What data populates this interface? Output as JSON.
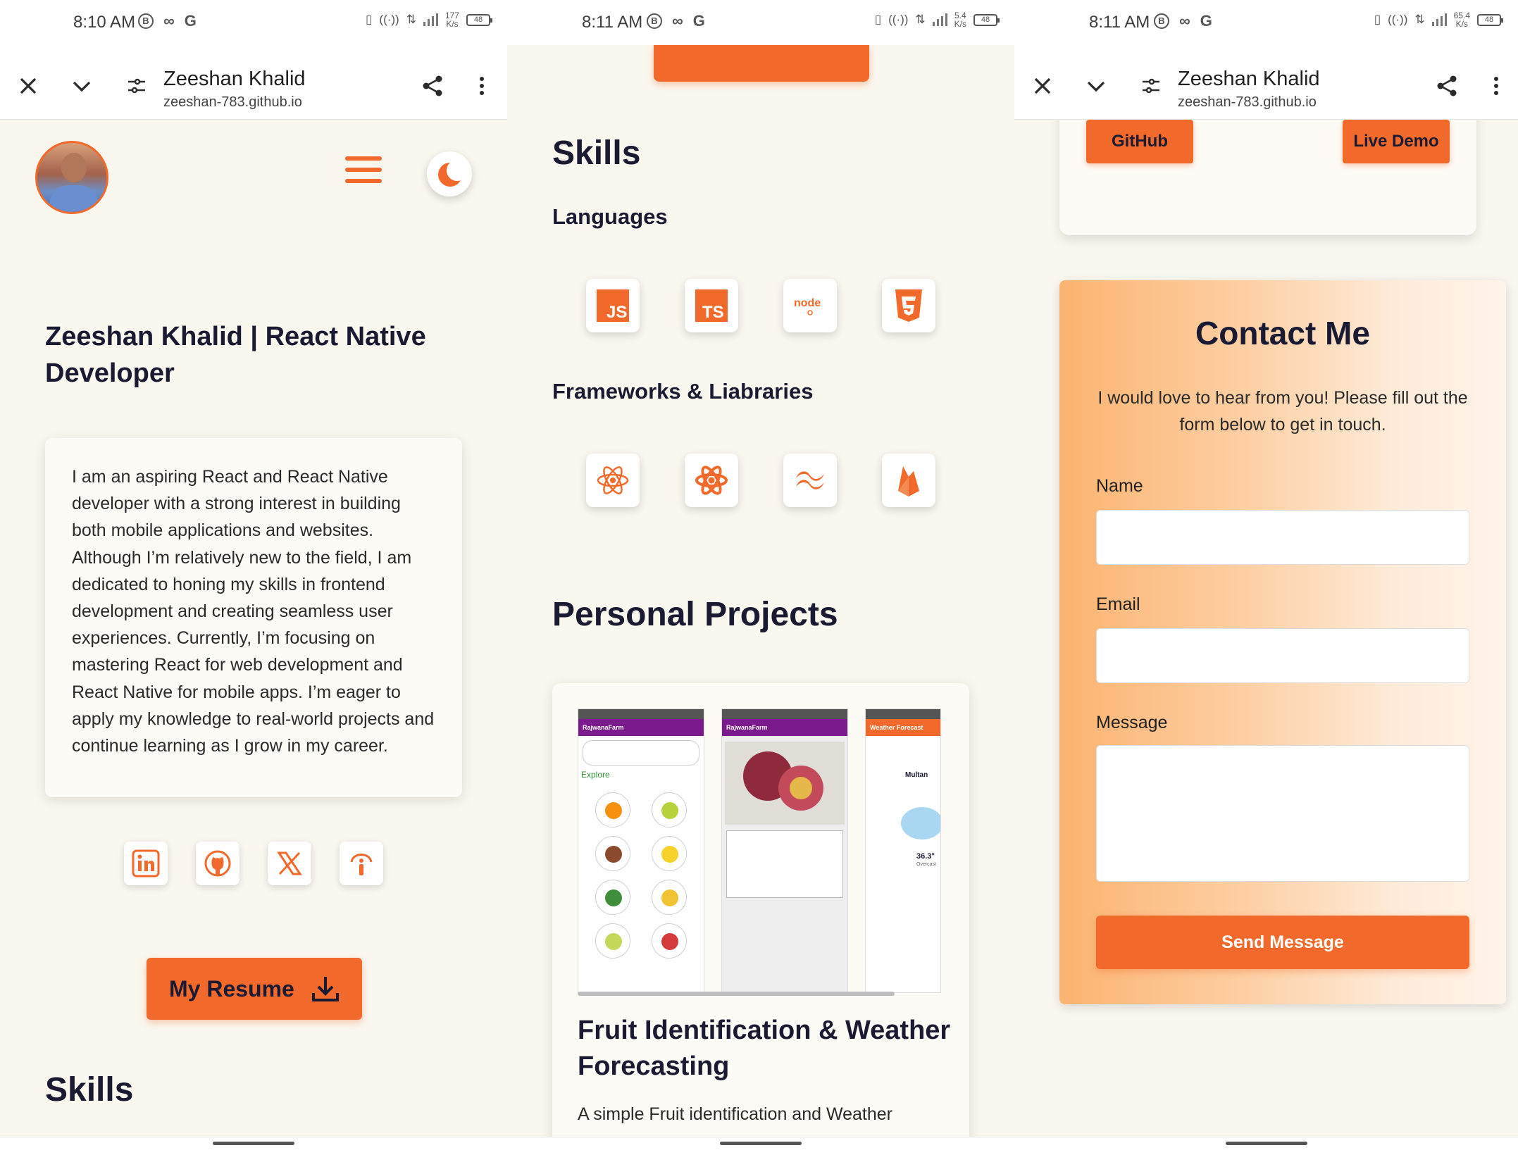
{
  "screens": [
    {
      "status": {
        "time": "8:10 AM",
        "net_speed": "177\nK/s",
        "net_type": "4G",
        "battery": "48"
      },
      "browser": {
        "title": "Zeeshan Khalid",
        "url": "zeeshan-783.github.io"
      }
    },
    {
      "status": {
        "time": "8:11 AM",
        "net_speed": "5.4\nK/s",
        "net_type": "4G",
        "battery": "48"
      }
    },
    {
      "status": {
        "time": "8:11 AM",
        "net_speed": "65.4\nK/s",
        "net_type": "4G",
        "battery": "48"
      },
      "browser": {
        "title": "Zeeshan Khalid",
        "url": "zeeshan-783.github.io"
      }
    }
  ],
  "hero": {
    "title": "Zeeshan Khalid | React Native Developer",
    "about": "I am an aspiring React and React Native developer with a strong interest in building both mobile applications and websites. Although I’m relatively new to the field, I am dedicated to honing my skills in frontend development and creating seamless user experiences. Currently, I’m focusing on mastering React for web development and React Native for mobile apps. I’m eager to apply my knowledge to real-world projects and continue learning as I grow in my career."
  },
  "social_icons": [
    "linkedin-icon",
    "github-icon",
    "x-twitter-icon",
    "info-icon"
  ],
  "resume_button": "My Resume",
  "skills": {
    "heading": "Skills",
    "languages_heading": "Languages",
    "languages": [
      "javascript-icon",
      "typescript-icon",
      "nodejs-icon",
      "html5-icon"
    ],
    "frameworks_heading": "Frameworks & Liabraries",
    "frameworks": [
      "react-icon",
      "react-native-icon",
      "tailwind-icon",
      "firebase-icon"
    ]
  },
  "projects": {
    "heading": "Personal Projects",
    "items": [
      {
        "title": "Fruit Identification & Weather Forecasting",
        "description": "A simple Fruit identification and Weather",
        "screens": [
          {
            "app": "RajwanaFarm",
            "section": "Explore"
          },
          {
            "app": "RajwanaFarm"
          },
          {
            "app": "Weather Forecast",
            "city": "Multan",
            "temp": "36.3°",
            "cond": "Overcast"
          }
        ],
        "github_label": "GitHub",
        "demo_label": "Live Demo"
      }
    ]
  },
  "contact": {
    "title": "Contact Me",
    "subtitle": "I would love to hear from you! Please fill out the form below to get in touch.",
    "name_label": "Name",
    "email_label": "Email",
    "message_label": "Message",
    "name_value": "",
    "email_value": "",
    "message_value": "",
    "send_label": "Send Message"
  },
  "colors": {
    "accent": "#f26a2b",
    "background": "#faf7ef",
    "text": "#1b1a33"
  }
}
